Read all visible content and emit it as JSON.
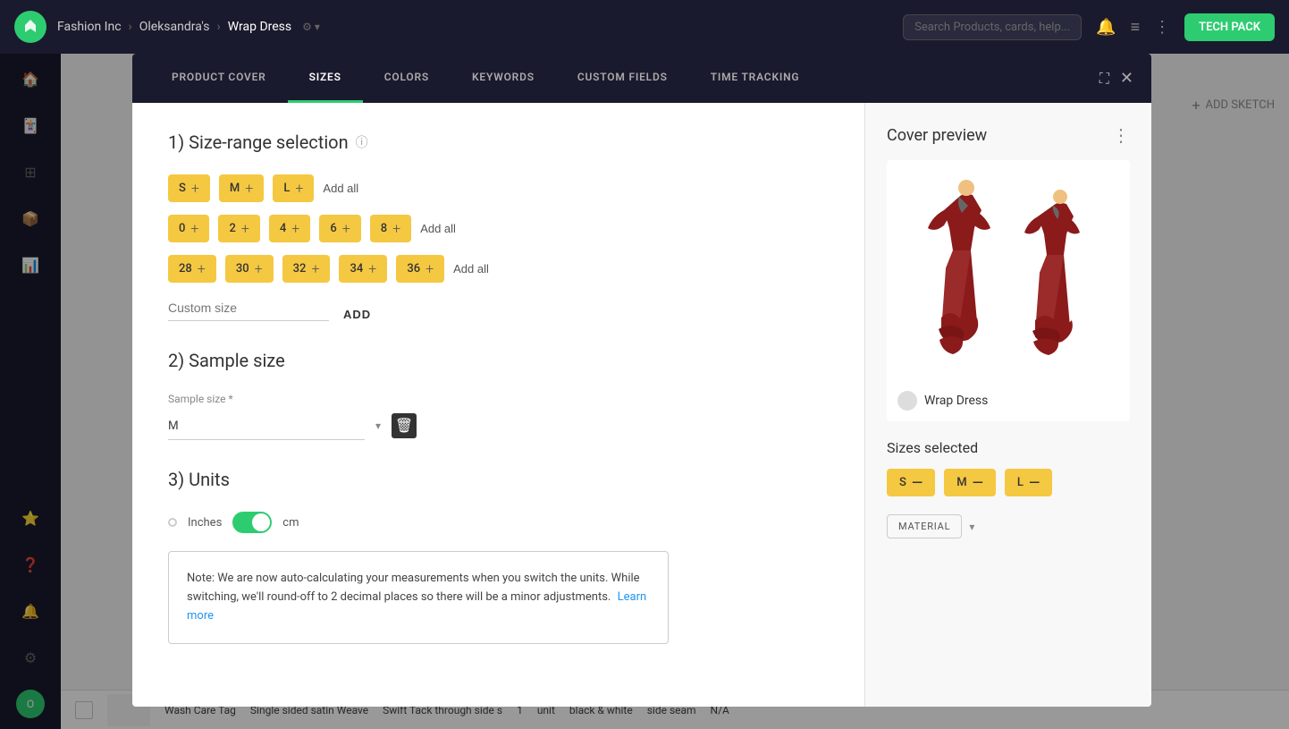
{
  "app": {
    "logo": "F",
    "breadcrumb": {
      "company": "Fashion Inc",
      "arrow1": "›",
      "person": "Oleksandra's",
      "arrow2": "›",
      "product": "Wrap Dress"
    },
    "search_placeholder": "Search Products, cards, help...",
    "tech_pack_label": "TECH PACK"
  },
  "modal": {
    "tabs": [
      {
        "id": "product-cover",
        "label": "PRODUCT COVER",
        "active": false
      },
      {
        "id": "sizes",
        "label": "SIZES",
        "active": true
      },
      {
        "id": "colors",
        "label": "COLORS",
        "active": false
      },
      {
        "id": "keywords",
        "label": "KEYWORDS",
        "active": false
      },
      {
        "id": "custom-fields",
        "label": "CUSTOM FIELDS",
        "active": false
      },
      {
        "id": "time-tracking",
        "label": "TIME TRACKING",
        "active": false
      }
    ],
    "close_icon": "✕",
    "expand_icon": "⛶"
  },
  "sizes_panel": {
    "section1_title": "1) Size-range selection",
    "info_icon": "ⓘ",
    "row1": {
      "chips": [
        "S",
        "M",
        "L"
      ],
      "add_all_label": "Add all"
    },
    "row2": {
      "chips": [
        "0",
        "2",
        "4",
        "6",
        "8"
      ],
      "add_all_label": "Add all"
    },
    "row3": {
      "chips": [
        "28",
        "30",
        "32",
        "34",
        "36"
      ],
      "add_all_label": "Add all"
    },
    "custom_size_placeholder": "Custom size",
    "add_button_label": "ADD",
    "section2_title": "2) Sample size",
    "sample_size_label": "Sample size *",
    "sample_size_value": "M",
    "section3_title": "3) Units",
    "unit_inches_label": "Inches",
    "unit_cm_label": "cm",
    "unit_radio_label": "○",
    "note_text": "Note: We are now auto-calculating your measurements when you switch the units. While switching, we'll round-off to 2 decimal places so there will be a minor adjustments.",
    "note_link_text": "Learn more",
    "note_link_url": "#"
  },
  "right_panel": {
    "cover_preview_title": "Cover preview",
    "menu_icon": "⋮",
    "product_name": "Wrap Dress",
    "sizes_selected_title": "Sizes selected",
    "selected_sizes": [
      "S",
      "M",
      "L"
    ],
    "add_sketch_label": "ADD SKETCH",
    "material_dropdown_label": "MATERIAL"
  },
  "bottom_table": {
    "row": {
      "name": "Wash Care Tag",
      "fabric": "Single sided satin Weave",
      "tack": "Swift Tack through side s",
      "qty": "1",
      "unit": "unit",
      "color": "black & white",
      "placement": "side seam",
      "note": "N/A"
    }
  }
}
